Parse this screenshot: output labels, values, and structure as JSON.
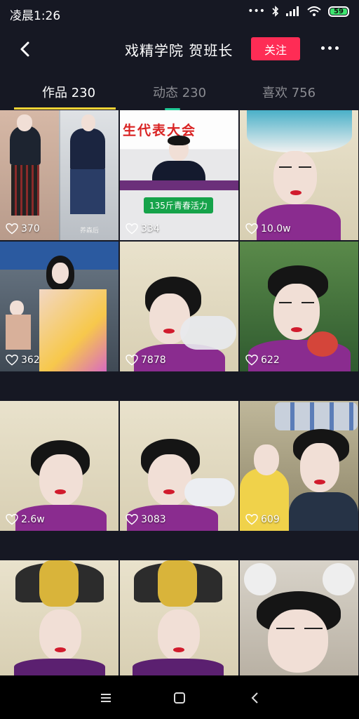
{
  "status_bar": {
    "time": "凌晨1:26",
    "icons": [
      "more-dots-icon",
      "bluetooth-icon",
      "signal-icon",
      "wifi-icon",
      "battery-icon"
    ],
    "battery": "59"
  },
  "header": {
    "title": "戏精学院 贺班长",
    "follow_label": "关注",
    "accent_color": "#fe2c55"
  },
  "tabs": [
    {
      "label": "作品 230",
      "active": true
    },
    {
      "label": "动态 230",
      "active": false
    },
    {
      "label": "喜欢 756",
      "active": false
    }
  ],
  "videos": [
    {
      "likes": "370",
      "watermark": "养森后"
    },
    {
      "likes": "334",
      "banner": "生代表大会",
      "badge": "135斤青春活力"
    },
    {
      "likes": "10.0w"
    },
    {
      "likes": "362"
    },
    {
      "likes": "7878"
    },
    {
      "likes": "622"
    },
    {
      "likes": "2.6w"
    },
    {
      "likes": "3083"
    },
    {
      "likes": "609"
    },
    {
      "likes": ""
    },
    {
      "likes": ""
    },
    {
      "likes": ""
    }
  ],
  "nav": [
    "menu-icon",
    "home-icon",
    "back-icon"
  ]
}
